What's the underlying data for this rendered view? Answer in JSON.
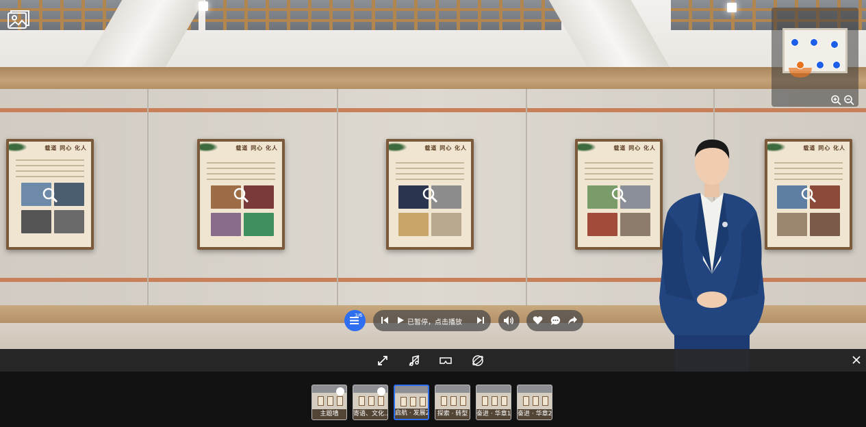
{
  "scene": {
    "posters": [
      {
        "title": "载道 同心 化人"
      },
      {
        "title": "载道 同心 化人"
      },
      {
        "title": "载道 同心 化人"
      },
      {
        "title": "载道 同心 化人"
      },
      {
        "title": "载道 同心 化人"
      }
    ]
  },
  "minimap": {
    "zoom_in_icon": "zoom-in-icon",
    "zoom_out_icon": "zoom-out-icon"
  },
  "player": {
    "menu_count": "3/6",
    "status_text": "已暂停，点击播放"
  },
  "thumbnails": [
    {
      "label": "主题墙",
      "visited": true,
      "active": false
    },
    {
      "label": "寄语、文化...",
      "visited": true,
      "active": false
    },
    {
      "label": "启航 · 发展2",
      "visited": false,
      "active": true
    },
    {
      "label": "探索 · 转型",
      "visited": false,
      "active": false
    },
    {
      "label": "奋进 · 华章1",
      "visited": false,
      "active": false
    },
    {
      "label": "奋进 · 华章2...",
      "visited": false,
      "active": false
    }
  ],
  "colors": {
    "accent": "#2e6ff2",
    "map_dot": "#1f5ee8",
    "map_me": "#e8731f",
    "wall_strip": "#c7805a"
  }
}
